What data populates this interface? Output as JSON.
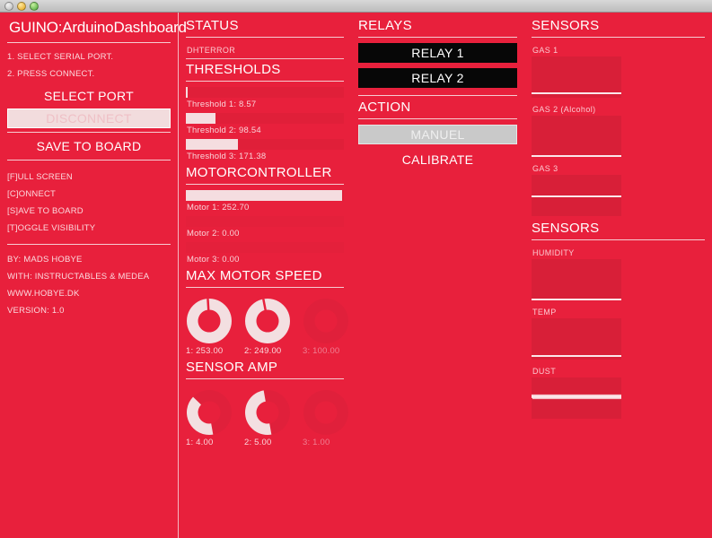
{
  "window": {
    "traffic_lights": [
      "close-button",
      "minimize-button",
      "zoom-button"
    ]
  },
  "left": {
    "app_title": "GUINO:ArduinoDashboard",
    "instructions": [
      "1. SELECT SERIAL PORT.",
      "2. PRESS CONNECT."
    ],
    "select_port_label": "SELECT PORT",
    "disconnect_label": "DISCONNECT",
    "save_to_board_label": "SAVE TO BOARD",
    "shortcuts": [
      "[F]ULL SCREEN",
      "[C]ONNECT",
      "[S]AVE TO BOARD",
      "[T]OGGLE VISIBILITY"
    ],
    "credits": [
      "BY: MADS HOBYE",
      "WITH: INSTRUCTABLES & MEDEA",
      "WWW.HOBYE.DK",
      "VERSION: 1.0"
    ]
  },
  "status": {
    "heading": "STATUS",
    "status_message": "DHTERROR",
    "thresholds_heading": "THRESHOLDS",
    "thresholds": [
      {
        "label": "Threshold 1: 8.57",
        "value": 8.57,
        "fill_percent": 1
      },
      {
        "label": "Threshold 2: 98.54",
        "value": 98.54,
        "fill_percent": 19
      },
      {
        "label": "Threshold 3: 171.38",
        "value": 171.38,
        "fill_percent": 33
      }
    ],
    "motorcontroller_heading": "MOTORCONTROLLER",
    "motors": [
      {
        "label": "Motor 1: 252.70",
        "value": 252.7,
        "fill_percent": 99
      },
      {
        "label": "Motor 2: 0.00",
        "value": 0.0,
        "fill_percent": 0
      },
      {
        "label": "Motor 3: 0.00",
        "value": 0.0,
        "fill_percent": 0
      }
    ],
    "max_motor_speed_heading": "MAX MOTOR SPEED",
    "max_motor_speed": [
      {
        "label": "1: 253.00",
        "value": 253.0,
        "angle_percent": 99,
        "active": true
      },
      {
        "label": "2: 249.00",
        "value": 249.0,
        "angle_percent": 97,
        "active": true
      },
      {
        "label": "3: 100.00",
        "value": 100.0,
        "angle_percent": 39,
        "active": false
      }
    ],
    "sensor_amp_heading": "SENSOR AMP",
    "sensor_amp": [
      {
        "label": "1: 4.00",
        "value": 4.0,
        "angle_percent": 40,
        "active": true
      },
      {
        "label": "2: 5.00",
        "value": 5.0,
        "angle_percent": 50,
        "active": true
      },
      {
        "label": "3: 1.00",
        "value": 1.0,
        "angle_percent": 10,
        "active": false
      }
    ]
  },
  "relays": {
    "heading": "RELAYS",
    "buttons": [
      "RELAY 1",
      "RELAY 2"
    ],
    "action_heading": "ACTION",
    "manuel_label": "MANUEL",
    "calibrate_label": "CALIBRATE"
  },
  "sensors": {
    "heading_top": "SENSORS",
    "heading_bottom": "SENSORS",
    "gas": [
      {
        "label": "GAS 1",
        "trace": "flat",
        "trace_position_percent": 88
      },
      {
        "label": "GAS 2 (Alcohol)",
        "trace": "flat",
        "trace_position_percent": 96
      },
      {
        "label": "GAS 3",
        "trace": "flat",
        "trace_position_percent": 50
      }
    ],
    "env": [
      {
        "label": "HUMIDITY",
        "trace": "flat",
        "trace_position_percent": 96
      },
      {
        "label": "TEMP",
        "trace": "flat",
        "trace_position_percent": 90
      },
      {
        "label": "DUST",
        "trace": "sawtooth",
        "trace_position_percent": 50
      }
    ]
  },
  "colors": {
    "background_red": "#e8203c",
    "graph_red": "#d81f38",
    "accent_white": "#ffffff",
    "relay_black": "#070707",
    "manuel_gray": "#c9c9c9",
    "disconnect_pink": "#f2dcdd"
  }
}
